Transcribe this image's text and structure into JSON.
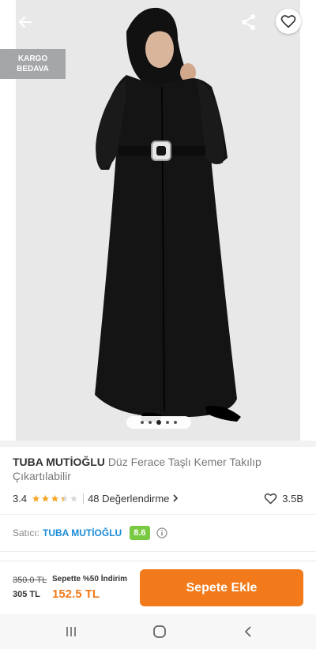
{
  "hero": {
    "badge_line1": "KARGO",
    "badge_line2": "BEDAVA",
    "image_count": 5,
    "active_image_index": 2
  },
  "icons": {
    "back": "arrow-left-icon",
    "share": "share-icon",
    "favorite": "heart-icon",
    "info": "info-icon"
  },
  "product": {
    "brand": "TUBA MUTİOĞLU",
    "name": "Düz Ferace Taşlı Kemer Takılıp Çıkartılabilir",
    "rating": "3.4",
    "rating_value": 3.4,
    "reviews_label": "48 Değerlendirme",
    "favorites": "3.5B"
  },
  "seller": {
    "label": "Satıcı:",
    "name": "TUBA MUTİOĞLU",
    "score": "8.6"
  },
  "pricing": {
    "old_price": "350.0 TL",
    "low_price": "305 TL",
    "promo": "Sepette %50 İndirim",
    "final_price": "152.5 TL",
    "cta": "Sepete Ekle"
  },
  "colors": {
    "accent": "#f27a1a",
    "seller_link": "#1b8cd8",
    "score_badge": "#7ac943",
    "star": "#f5a623"
  }
}
